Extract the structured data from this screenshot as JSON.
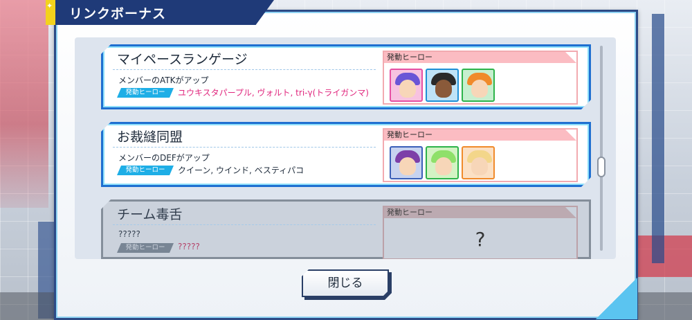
{
  "dialog": {
    "title": "リンクボーナス",
    "close_label": "閉じる"
  },
  "bonuses": [
    {
      "name": "マイペースランゲージ",
      "description": "メンバーのATKがアップ",
      "tag": "発動ヒーロー",
      "heroes": "ユウキスタパープル, ヴォルト, tri-γ(トライガンマ)",
      "panel_label": "発動ヒーロー",
      "portraits": [
        {
          "icon": "hero-portrait-purple",
          "border": "#e64fa2",
          "hair": "#6a55d6"
        },
        {
          "icon": "hero-portrait-volt",
          "border": "#1e8fd6",
          "hair": "#2a2a2a"
        },
        {
          "icon": "hero-portrait-trigamma",
          "border": "#2db34a",
          "hair": "#f08a2a"
        }
      ]
    },
    {
      "name": "お裁縫同盟",
      "description": "メンバーのDEFがアップ",
      "tag": "発動ヒーロー",
      "heroes": "クイーン, ウインド, ベスティパコ",
      "panel_label": "発動ヒーロー",
      "portraits": [
        {
          "icon": "hero-portrait-queen",
          "border": "#3a5fb8",
          "hair": "#7d3fa8"
        },
        {
          "icon": "hero-portrait-wind",
          "border": "#2db34a",
          "hair": "#8fe06a"
        },
        {
          "icon": "hero-portrait-bestipaco",
          "border": "#f08a2a",
          "hair": "#f3d68a"
        }
      ]
    },
    {
      "name": "チーム毒舌",
      "description": "?????",
      "tag": "発動ヒーロー",
      "heroes": "?????",
      "panel_label": "発動ヒーロー",
      "unknown_mark": "?"
    }
  ]
}
